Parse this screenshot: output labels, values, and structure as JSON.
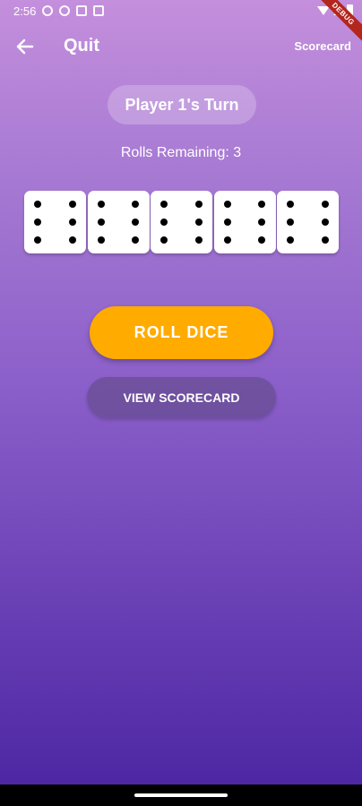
{
  "status_bar": {
    "time": "2:56",
    "icons": [
      "notification-info-icon",
      "shield-icon",
      "sim-card-icon",
      "app-notification-icon",
      "wifi-icon",
      "signal-icon",
      "battery-icon"
    ]
  },
  "debug_banner": "DEBUG",
  "app_bar": {
    "back_icon": "arrow-left-icon",
    "title": "Quit",
    "scorecard_label": "Scorecard"
  },
  "game": {
    "turn_label": "Player 1's Turn",
    "rolls_remaining": "Rolls Remaining: 3",
    "dice": [
      6,
      6,
      6,
      6,
      6
    ]
  },
  "buttons": {
    "roll": "ROLL DICE",
    "view_scorecard": "VIEW SCORECARD"
  },
  "colors": {
    "accent": "#ffab00",
    "gradient_top": "#c48fdc",
    "gradient_bottom": "#4a24a2"
  }
}
